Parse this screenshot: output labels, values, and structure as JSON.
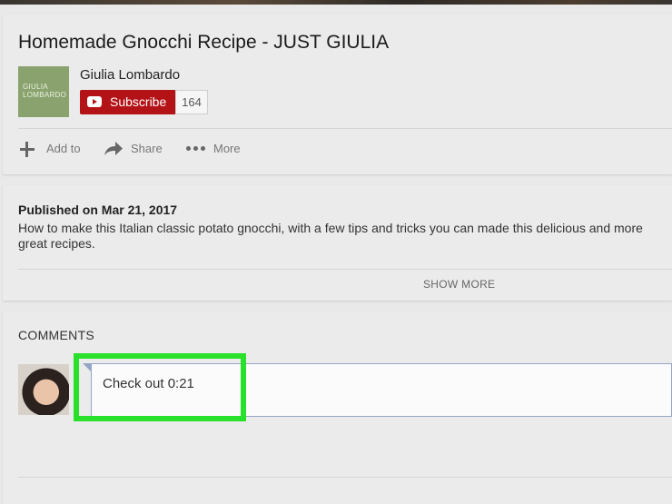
{
  "video": {
    "title": "Homemade Gnocchi Recipe - JUST GIULIA",
    "channel_name": "Giulia Lombardo",
    "channel_thumb_text": "GIULIA\nLOMBARDO",
    "subscribe_label": "Subscribe",
    "subscriber_count": "164",
    "actions": [
      {
        "label": "Add to",
        "icon": "plus-icon"
      },
      {
        "label": "Share",
        "icon": "share-arrow-icon"
      },
      {
        "label": "More",
        "icon": "more-dots-icon"
      }
    ]
  },
  "description": {
    "published": "Published on Mar 21, 2017",
    "text": "How to make this Italian classic potato gnocchi, with a few tips and tricks you can made this delicious and more great recipes.",
    "show_more": "SHOW MORE"
  },
  "comments": {
    "heading": "COMMENTS",
    "draft_text": "Check out 0:21"
  },
  "colors": {
    "subscribe_red": "#b31217",
    "highlight_green": "#29e02b",
    "comment_border": "#94a6c8"
  }
}
